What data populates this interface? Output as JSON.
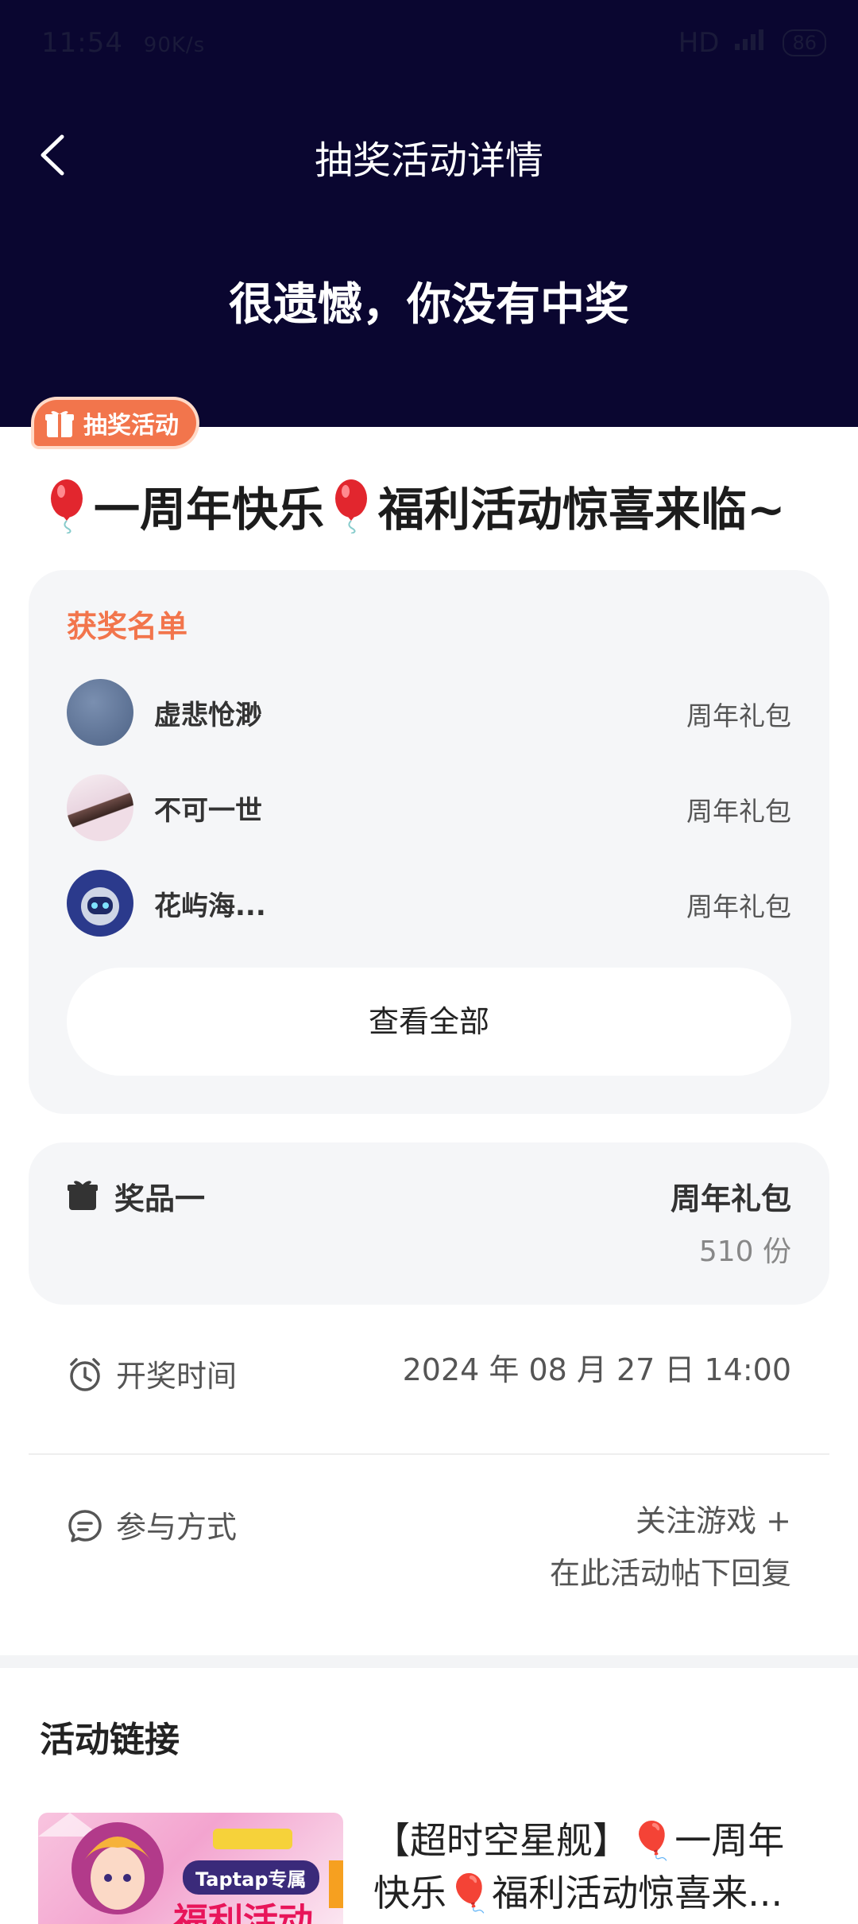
{
  "status_bar": {
    "time": "11:54",
    "left_extra": "90K/s",
    "network": "HD",
    "battery": "86"
  },
  "nav": {
    "title": "抽奖活动详情"
  },
  "result": {
    "title": "很遗憾，你没有中奖"
  },
  "badge": {
    "label": "抽奖活动"
  },
  "post": {
    "title_part1": "一周年快乐",
    "title_part2": "福利活动惊喜来临~"
  },
  "winners": {
    "heading": "获奖名单",
    "items": [
      {
        "name": "虚悲怆渺",
        "prize": "周年礼包"
      },
      {
        "name": "不可一世",
        "prize": "周年礼包"
      },
      {
        "name": "花屿海...",
        "prize": "周年礼包"
      }
    ],
    "view_all": "查看全部"
  },
  "prize": {
    "label": "奖品一",
    "name": "周年礼包",
    "count": "510 份"
  },
  "draw_time": {
    "label": "开奖时间",
    "value": "2024 年 08 月 27 日 14:00"
  },
  "participation": {
    "label": "参与方式",
    "line1": "关注游戏 +",
    "line2": "在此活动帖下回复"
  },
  "links": {
    "heading": "活动链接",
    "thumb_tag": "Taptap专属",
    "thumb_text": "福利活动",
    "title": "【超时空星舰】🎈一周年快乐🎈福利活动惊喜来..."
  }
}
